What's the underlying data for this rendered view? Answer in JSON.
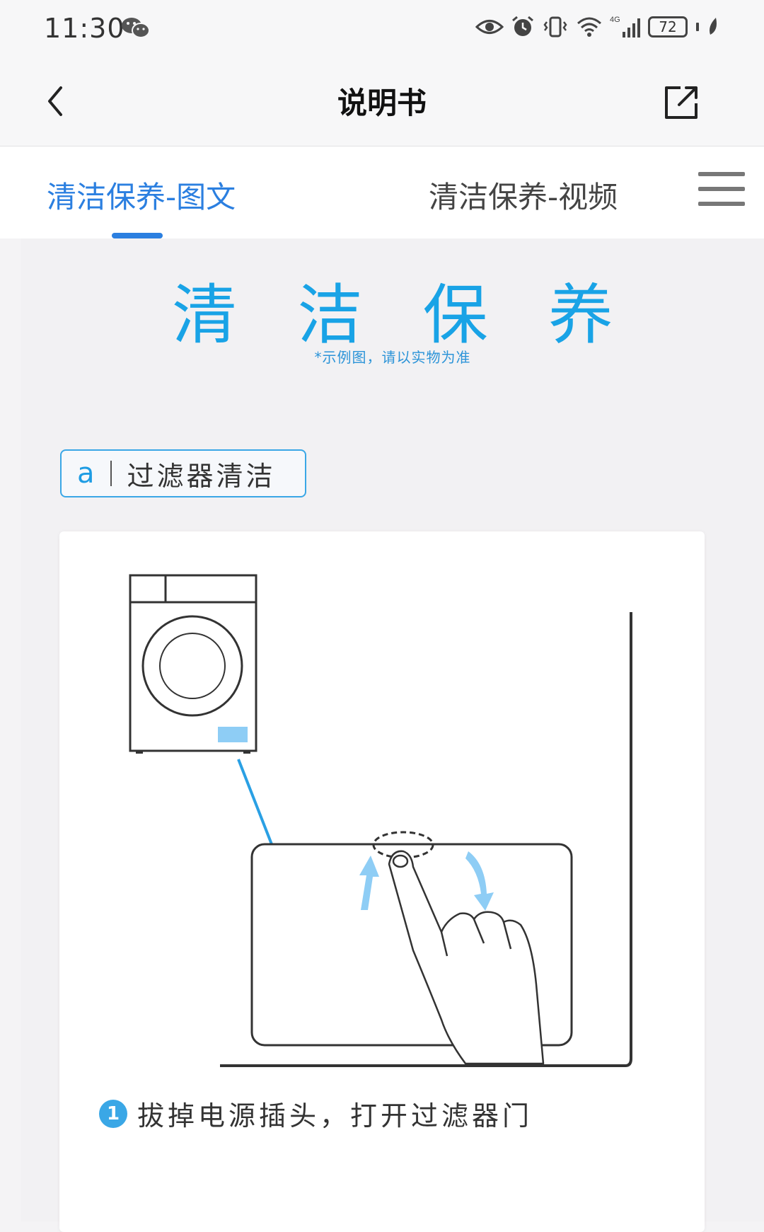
{
  "status_bar": {
    "time": "11:30",
    "network": "4G",
    "battery": "72",
    "icons": [
      "wechat-icon",
      "eye-icon",
      "alarm-icon",
      "vibrate-icon",
      "wifi-icon",
      "signal-icon",
      "battery-icon",
      "leaf-icon"
    ]
  },
  "header": {
    "title": "说明书",
    "back_icon": "chevron-left-icon",
    "share_icon": "share-external-icon"
  },
  "tabs": {
    "items": [
      {
        "label": "清洁保养-图文",
        "active": true
      },
      {
        "label": "清洁保养-视频",
        "active": false
      }
    ],
    "menu_icon": "hamburger-menu-icon"
  },
  "content": {
    "hero_title": "清 洁 保 养",
    "hero_subtitle": "*示例图，请以实物为准",
    "section": {
      "letter": "a",
      "title": "过滤器清洁"
    },
    "step": {
      "number": "1",
      "text": "拔掉电源插头，打开过滤器门"
    }
  },
  "colors": {
    "accent": "#2b7fe0",
    "hero": "#19a3e6",
    "illustration_blue": "#8ecdf5",
    "background": "#f2f1f3"
  }
}
